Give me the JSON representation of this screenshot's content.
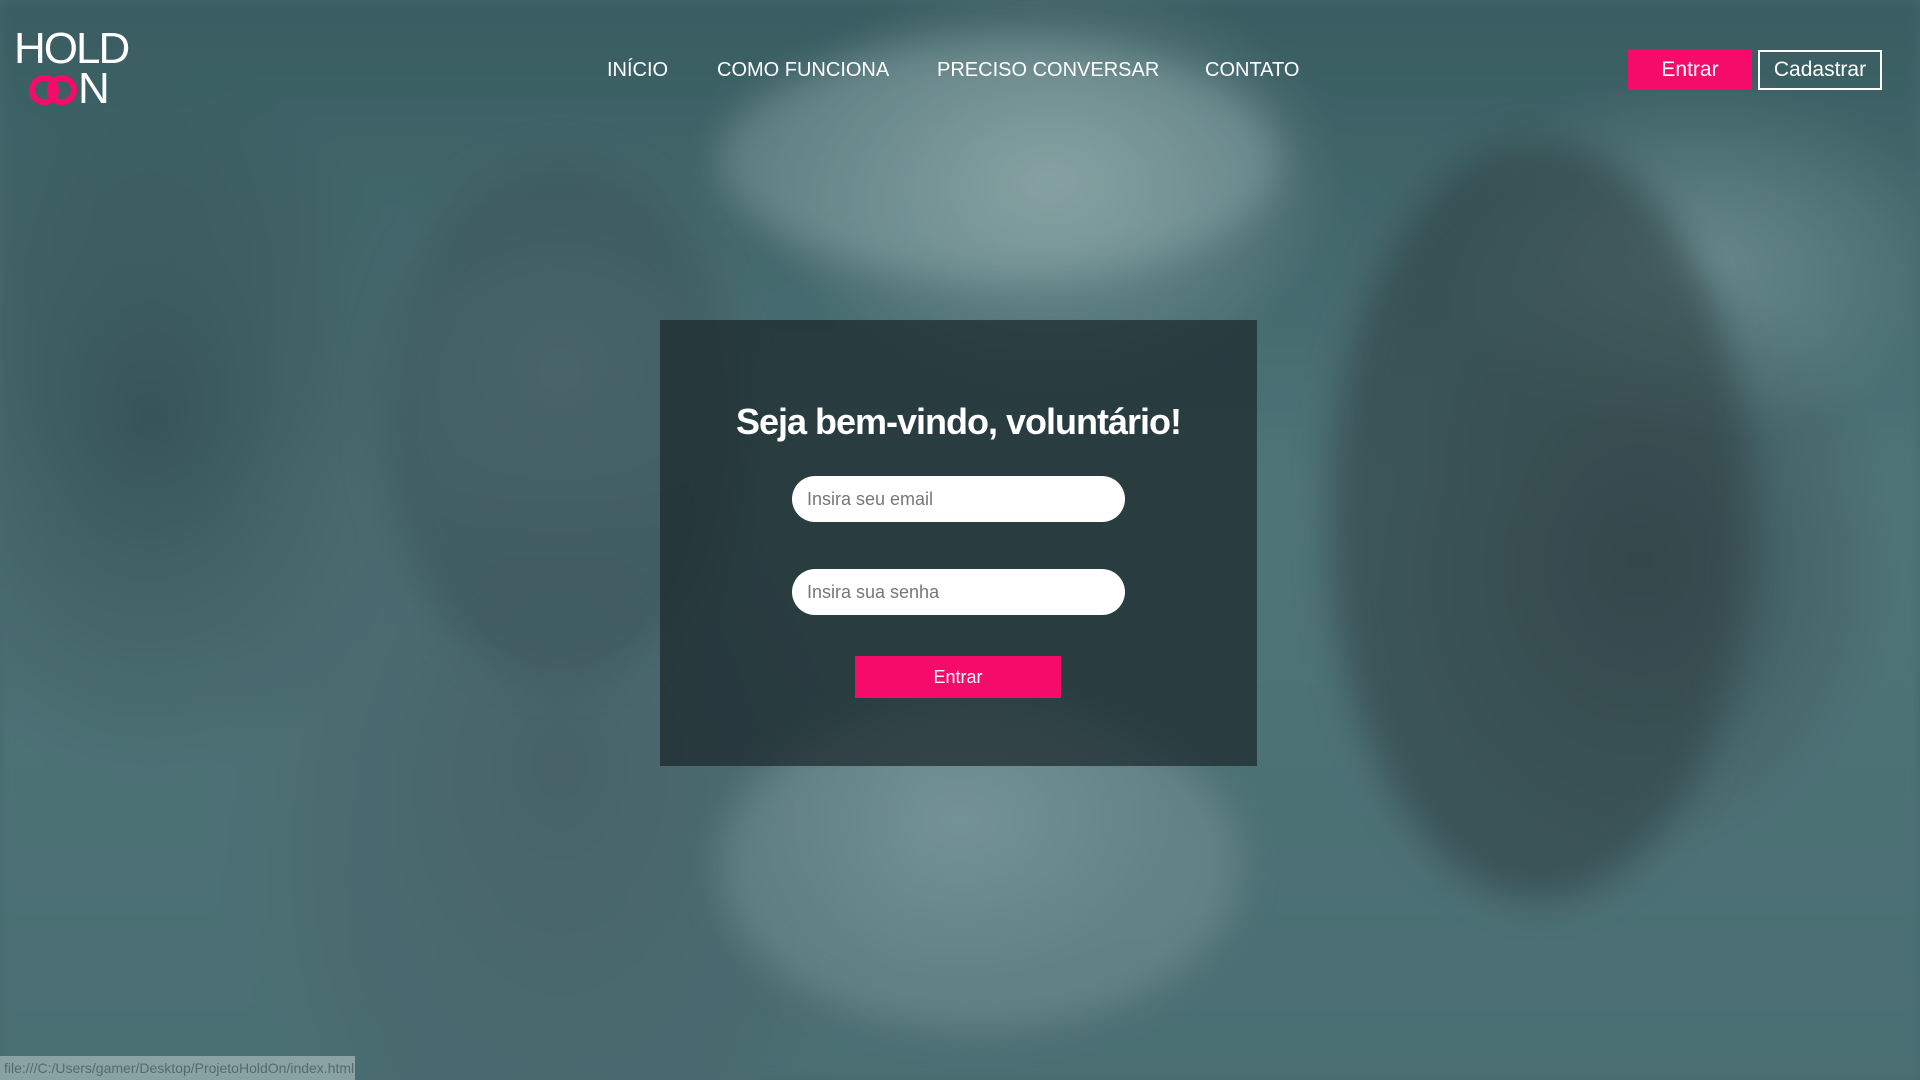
{
  "brand": {
    "logo_top": "HOLD",
    "logo_bottom": "N",
    "accent_color": "#f50b6a"
  },
  "nav": {
    "items": [
      {
        "label": "INÍCIO"
      },
      {
        "label": "COMO FUNCIONA"
      },
      {
        "label": "PRECISO CONVERSAR"
      },
      {
        "label": "CONTATO"
      }
    ]
  },
  "header_actions": {
    "login_label": "Entrar",
    "signup_label": "Cadastrar"
  },
  "login_panel": {
    "title": "Seja bem-vindo, voluntário!",
    "email_placeholder": "Insira seu email",
    "email_value": "",
    "password_placeholder": "Insira sua senha",
    "password_value": "",
    "submit_label": "Entrar"
  },
  "status_bar": {
    "text": "file:///C:/Users/gamer/Desktop/ProjetoHoldOn/index.html"
  }
}
